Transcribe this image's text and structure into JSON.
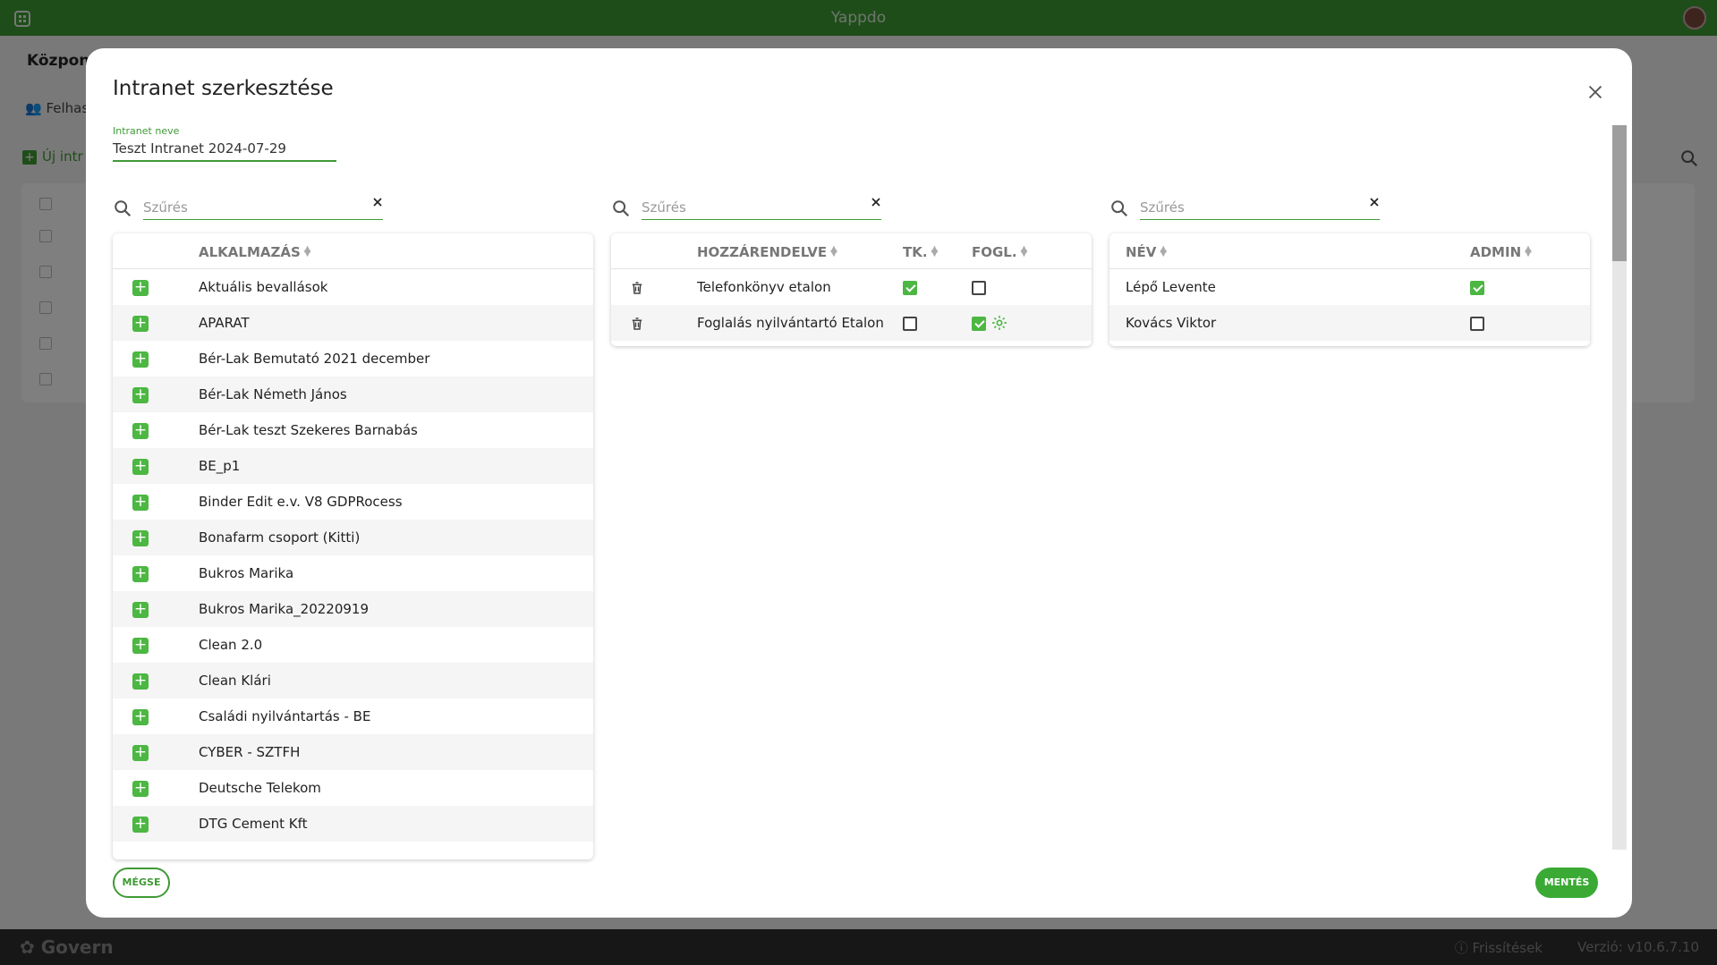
{
  "app": {
    "title": "Yappdo"
  },
  "background": {
    "title": "Központi",
    "tab_label": "Felhas",
    "new_label": "Új intr"
  },
  "footer": {
    "logo": "Govern",
    "refresh_label": "Frissítések",
    "version": "Verzió: v10.6.7.10"
  },
  "modal": {
    "title": "Intranet szerkesztése",
    "name_field": {
      "label": "Intranet neve",
      "value": "Teszt Intranet 2024-07-29"
    },
    "filter_placeholder": "Szűrés",
    "apps_panel": {
      "header": "ALKALMAZÁS",
      "rows": [
        "Aktuális bevallások",
        "APARAT",
        "Bér-Lak Bemutató 2021 december",
        "Bér-Lak Németh János",
        "Bér-Lak teszt Szekeres Barnabás",
        "BE_p1",
        "Binder Edit e.v. V8 GDPRocess",
        "Bonafarm csoport (Kitti)",
        "Bukros Marika",
        "Bukros Marika_20220919",
        "Clean 2.0",
        "Clean Klári",
        "Családi nyilvántartás - BE",
        "CYBER - SZTFH",
        "Deutsche Telekom",
        "DTG Cement Kft"
      ]
    },
    "assigned_panel": {
      "headers": {
        "name": "HOZZÁRENDELVE",
        "tk": "TK.",
        "fogl": "FOGL."
      },
      "rows": [
        {
          "name": "Telefonkönyv etalon",
          "tk": true,
          "fogl": false,
          "gear": false
        },
        {
          "name": "Foglalás nyilvántartó Etalon",
          "tk": false,
          "fogl": true,
          "gear": true
        }
      ]
    },
    "users_panel": {
      "headers": {
        "name": "NÉV",
        "admin": "ADMIN"
      },
      "rows": [
        {
          "name": "Lépő Levente",
          "admin": true
        },
        {
          "name": "Kovács Viktor",
          "admin": false
        }
      ]
    },
    "cancel_label": "MÉGSE",
    "save_label": "MENTÉS"
  },
  "colors": {
    "primary": "#3f9a35",
    "accent": "#4cb742"
  }
}
